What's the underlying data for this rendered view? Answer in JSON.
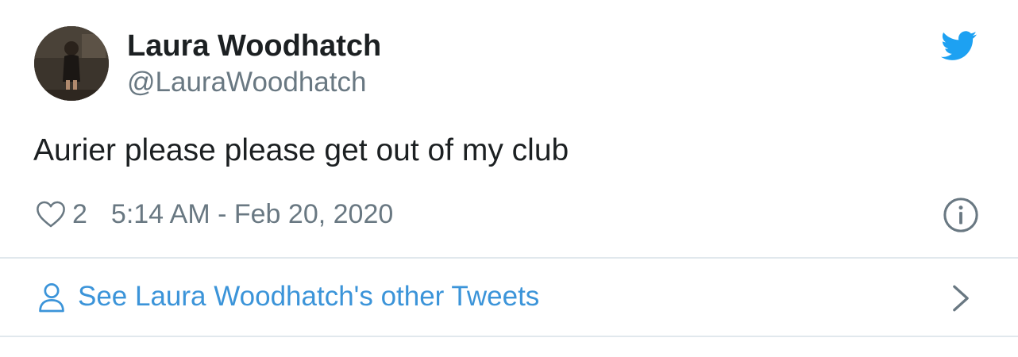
{
  "author": {
    "display_name": "Laura Woodhatch",
    "handle": "@LauraWoodhatch",
    "avatar_icon": "avatar-photo"
  },
  "tweet": {
    "text": "Aurier please please get out of my club",
    "like_count": "2",
    "timestamp": "5:14 AM - Feb 20, 2020"
  },
  "footer": {
    "more_tweets_label": "See Laura Woodhatch's other Tweets"
  },
  "icons": {
    "brand": "twitter-bird-icon",
    "like": "heart-icon",
    "info": "info-icon",
    "profile": "person-icon",
    "navigate": "chevron-right-icon"
  },
  "colors": {
    "twitter_blue": "#1da1f2",
    "link_blue": "#3b94d9",
    "secondary_text": "#697882",
    "primary_text": "#1c2022",
    "divider": "#e1e8ed"
  }
}
